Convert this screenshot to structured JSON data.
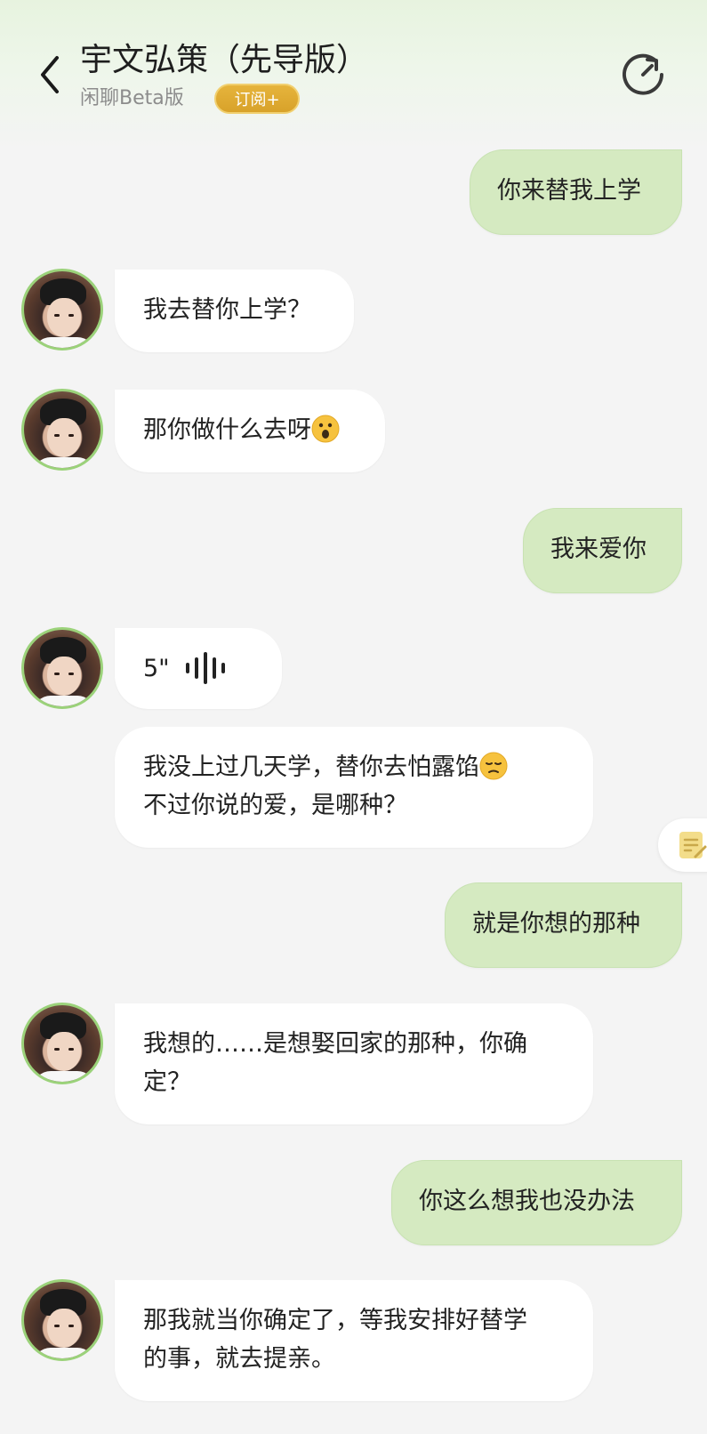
{
  "header": {
    "title": "宇文弘策（先导版）",
    "subtitle": "闲聊Beta版",
    "subscribe_label": "订阅+"
  },
  "icons": {
    "back": "chevron-left-icon",
    "refresh": "refresh-icon",
    "note": "note-icon",
    "voice": "soundwave-icon"
  },
  "colors": {
    "user_bubble": "#d5eac1",
    "bot_bubble": "#ffffff",
    "subscribe_badge": "#d8a22a",
    "avatar_ring": "#9bd27a",
    "background": "#f4f4f4"
  },
  "messages": [
    {
      "from": "user",
      "text": "你来替我上学"
    },
    {
      "from": "bot",
      "text": "我去替你上学？"
    },
    {
      "from": "bot",
      "text": "那你做什么去呀",
      "emoji": "surprised-face"
    },
    {
      "from": "user",
      "text": "我来爱你"
    },
    {
      "from": "bot",
      "type": "voice",
      "duration": "5\""
    },
    {
      "from": "bot",
      "lines": [
        "我没上过几天学，替你去怕露馅",
        "不过你说的爱，是哪种？"
      ],
      "emoji": "pensive-face"
    },
    {
      "from": "user",
      "text": "就是你想的那种"
    },
    {
      "from": "bot",
      "lines": [
        "我想的……是想娶回家的那种，你确",
        "定？"
      ]
    },
    {
      "from": "user",
      "text": "你这么想我也没办法"
    },
    {
      "from": "bot",
      "lines": [
        "那我就当你确定了，等我安排好替学",
        "的事，就去提亲。"
      ]
    }
  ]
}
